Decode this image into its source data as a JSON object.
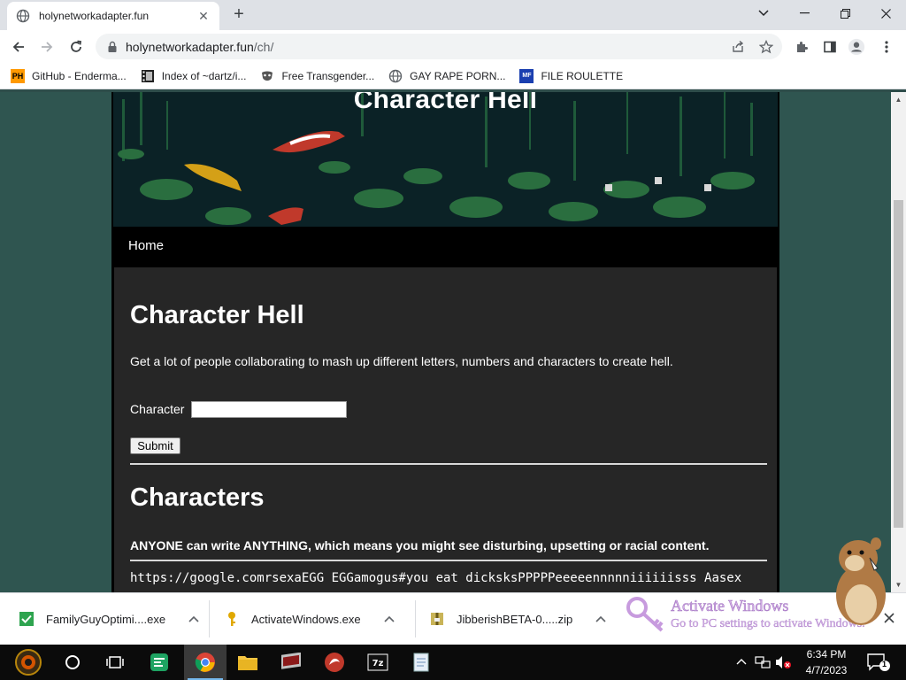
{
  "tab": {
    "title": "holynetworkadapter.fun",
    "close": "✕"
  },
  "window": {
    "minimize": "—",
    "maximize": "❐",
    "close": "✕",
    "tabsearch": "⌄"
  },
  "toolbar": {
    "url_host": "holynetworkadapter.fun",
    "url_path": "/ch/"
  },
  "bookmarks": [
    {
      "label": "GitHub - Enderma...",
      "icon": "ph-icon",
      "icon_text": "PH"
    },
    {
      "label": "Index of ~dartz/i...",
      "icon": "film-icon"
    },
    {
      "label": "Free Transgender...",
      "icon": "mask-icon"
    },
    {
      "label": "GAY RAPE PORN...",
      "icon": "globe-icon"
    },
    {
      "label": "FILE ROULETTE",
      "icon": "mf-icon",
      "icon_text": "MF"
    }
  ],
  "page": {
    "banner_title": "Character Hell",
    "nav_home": "Home",
    "heading": "Character Hell",
    "description": "Get a lot of people collaborating to mash up different letters, numbers and characters to create hell.",
    "character_label": "Character",
    "character_value": "",
    "submit_label": "Submit",
    "characters_heading": "Characters",
    "warning": "ANYONE can write ANYTHING, which means you might see disturbing, upsetting or racial content.",
    "characters_output": "https://google.comrsexaEGG EGGamogus#you eat dicksksPPPPPeeeeennnnniiiiiisss Aasex"
  },
  "downloads": [
    {
      "name": "FamilyGuyOptimi....exe",
      "icon": "check-icon"
    },
    {
      "name": "ActivateWindows.exe",
      "icon": "key-icon"
    },
    {
      "name": "JibberishBETA-0.....zip",
      "icon": "archive-icon"
    }
  ],
  "activate_windows": {
    "line1": "Activate Windows",
    "line2": "Go to PC settings to activate Windows."
  },
  "clock": {
    "time": "6:34 PM",
    "date": "4/7/2023"
  },
  "notification_count": "1",
  "colors": {
    "page_bg": "#2f5550",
    "content_bg": "#262626",
    "banner_bg": "#0a1f22"
  }
}
